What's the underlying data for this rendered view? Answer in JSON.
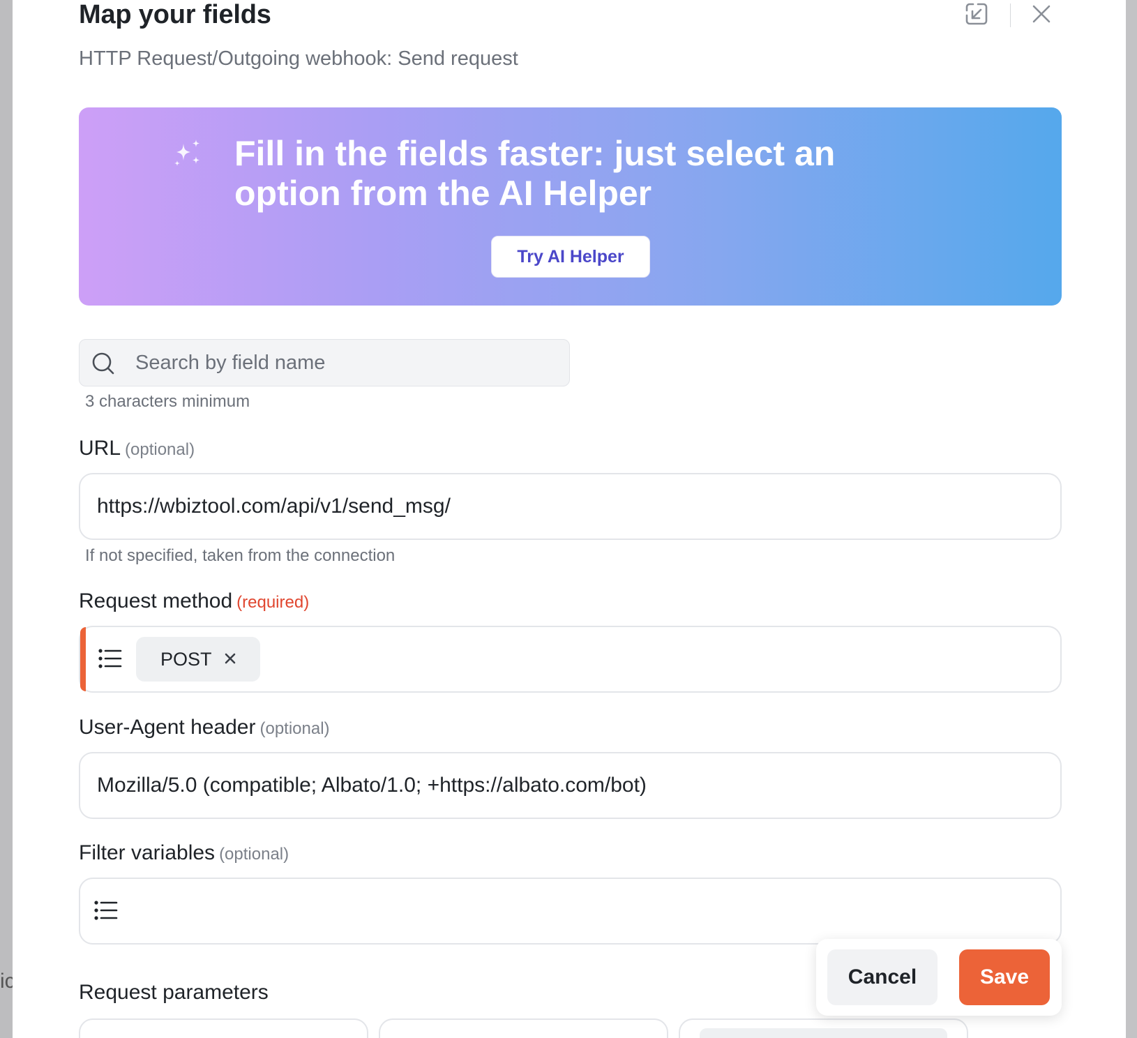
{
  "header": {
    "title": "Map your fields",
    "subtitle": "HTTP Request/Outgoing webhook: Send request",
    "icons": [
      "collapse-icon",
      "close-icon"
    ]
  },
  "backdrop": {
    "left_fragment": "ic"
  },
  "banner": {
    "text": "Fill in the fields faster: just select an option from the AI Helper",
    "button_label": "Try AI Helper",
    "gradient_colors": [
      "#cd9ff7",
      "#aa9ef4",
      "#86a7ef",
      "#55a8ec"
    ]
  },
  "search": {
    "placeholder": "Search by field name",
    "value": "",
    "hint": "3 characters minimum"
  },
  "fields": {
    "url": {
      "label": "URL",
      "tag": "(optional)",
      "value": "https://wbiztool.com/api/v1/send_msg/",
      "hint": "If not specified, taken from the connection"
    },
    "request_method": {
      "label": "Request method",
      "tag": "(required)",
      "chip": "POST"
    },
    "user_agent": {
      "label": "User-Agent header",
      "tag": "(optional)",
      "value": "Mozilla/5.0 (compatible; Albato/1.0; +https://albato.com/bot)"
    },
    "filter_variables": {
      "label": "Filter variables",
      "tag": "(optional)",
      "value": ""
    }
  },
  "request_parameters": {
    "label": "Request parameters"
  },
  "footer": {
    "cancel_label": "Cancel",
    "save_label": "Save"
  },
  "colors": {
    "accent": "#ec6338",
    "required": "#e0462f",
    "link_button": "#4b47c9"
  }
}
